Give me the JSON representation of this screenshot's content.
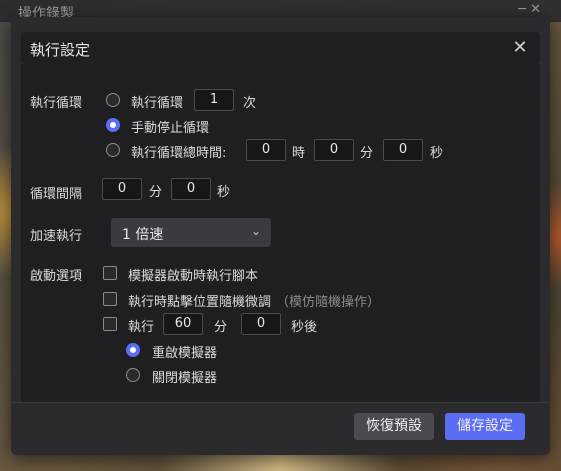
{
  "background": {
    "window_title": "操作錄製",
    "window_controls": "─ ✕"
  },
  "dialog": {
    "title": "執行設定",
    "close_icon": "✕",
    "loop": {
      "label": "執行循環",
      "option_count_label": "執行循環",
      "count_value": "1",
      "count_unit": "次",
      "option_manual_label": "手動停止循環",
      "option_total_label": "執行循環總時間:",
      "total_hours": "0",
      "hours_unit": "時",
      "total_minutes": "0",
      "minutes_unit": "分",
      "total_seconds": "0",
      "seconds_unit": "秒",
      "selected": "manual"
    },
    "interval": {
      "label": "循環間隔",
      "minutes": "0",
      "minutes_unit": "分",
      "seconds": "0",
      "seconds_unit": "秒"
    },
    "speed": {
      "label": "加速執行",
      "selected": "1 倍速",
      "chevron": "⌄"
    },
    "startup": {
      "label": "啟動選項",
      "opt_run_on_start": "模擬器啟動時執行腳本",
      "opt_random_offset": "執行時點擊位置隨機微調",
      "opt_random_offset_hint": "（模仿隨機操作）",
      "opt_run_after_prefix": "執行",
      "run_after_minutes": "60",
      "run_after_minutes_unit": "分",
      "run_after_seconds": "0",
      "run_after_seconds_unit": "秒後",
      "sub_restart": "重啟模擬器",
      "sub_close": "關閉模擬器",
      "sub_selected": "restart"
    },
    "footer": {
      "reset_label": "恢復預設",
      "save_label": "儲存設定"
    },
    "colors": {
      "accent": "#5b6cf5",
      "panel": "#1f1f22",
      "dialog": "#2b2b2e"
    }
  }
}
